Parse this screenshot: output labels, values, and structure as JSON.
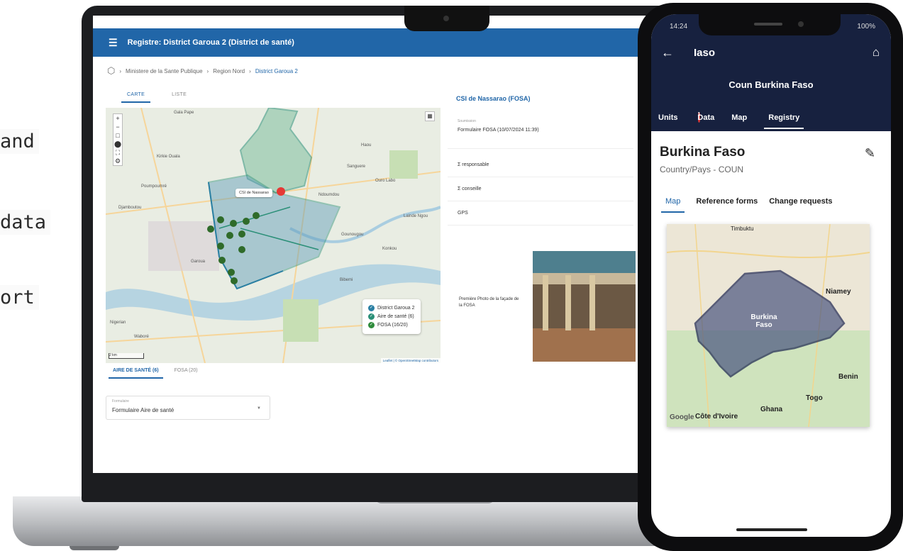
{
  "side_text": [
    "and",
    "data",
    "ort"
  ],
  "laptop": {
    "app_title": "Registre: District Garoua 2 (District de santé)",
    "breadcrumbs": [
      "Ministere de la Sante Publique",
      "Region Nord",
      "District Garoua 2"
    ],
    "map_tabs": [
      "CARTE",
      "LISTE"
    ],
    "map": {
      "popup": "CSI de Nassarao",
      "places": [
        "Gala Pape",
        "Garoua",
        "Kirkie Ouala",
        "Djamboutou",
        "Poumpoumré",
        "Gounougou",
        "Haou",
        "Konkou",
        "Nigerian",
        "Waboré",
        "Ouro Labo",
        "Bibemi",
        "Lainde Ngou",
        "Ndoumdou",
        "Sanguere"
      ],
      "legend": [
        {
          "label": "District Garoua 2",
          "color": "#2a7fa3"
        },
        {
          "label": "Aire de santé (6)",
          "color": "#2a8f77"
        },
        {
          "label": "FOSA (16/20)",
          "color": "#2f8c3c"
        }
      ],
      "scale": "2 km",
      "attribution": "Leaflet | © OpenStreetMap contributors"
    },
    "detail": {
      "title": "CSI de Nassarao (FOSA)",
      "form_label": "Soumission",
      "form_value": "Formulaire FOSA (10/07/2024 11:39)",
      "fields": [
        "responsable",
        "conseille",
        "GPS"
      ],
      "photo_label": "Première Photo de la façade de la FOSA"
    },
    "bottom_tabs": [
      "AIRE DE SANTÉ (6)",
      "FOSA (20)"
    ],
    "select": {
      "label": "Formulaire",
      "value": "Formulaire Aire de santé"
    }
  },
  "phone": {
    "status_time": "14:24",
    "status_battery": "100%",
    "title": "Iaso",
    "subtitle": "Coun Burkina Faso",
    "tabs": [
      "Units",
      "Data",
      "Map",
      "Registry"
    ],
    "units_badge": "1",
    "active_tab": "Registry",
    "entity_name": "Burkina Faso",
    "entity_type": "Country/Pays - COUN",
    "subtabs": [
      "Map",
      "Reference forms",
      "Change requests"
    ],
    "map_labels": [
      "Timbuktu",
      "Niamey",
      "Burkina Faso",
      "Benin",
      "Togo",
      "Ghana",
      "Côte d'Ivoire"
    ],
    "map_brand": "Google"
  }
}
